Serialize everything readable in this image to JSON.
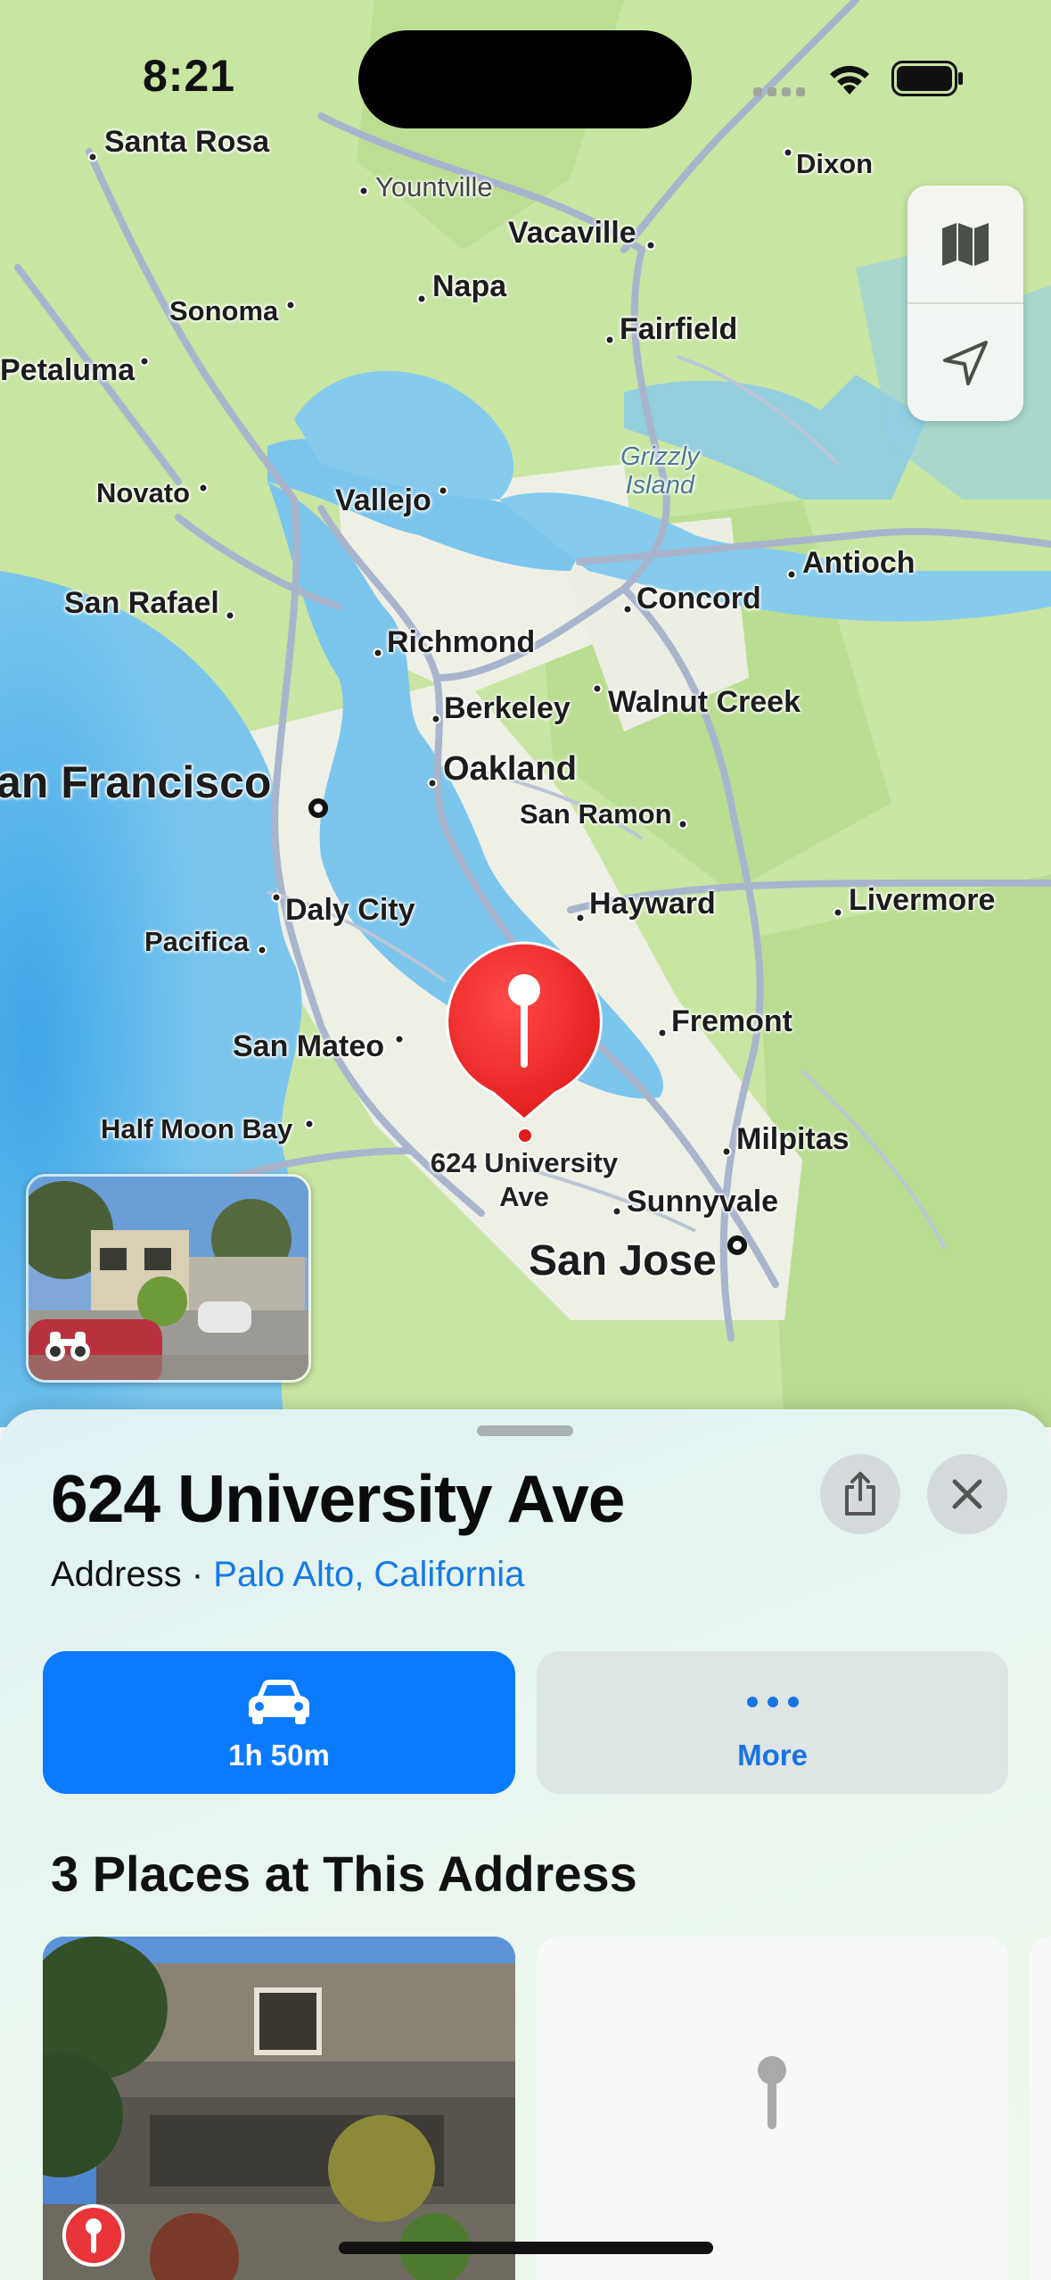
{
  "status_bar": {
    "time": "8:21"
  },
  "map": {
    "cities": [
      {
        "name": "Santa Rosa"
      },
      {
        "name": "Yountville"
      },
      {
        "name": "Dixon"
      },
      {
        "name": "Vacaville"
      },
      {
        "name": "Napa"
      },
      {
        "name": "Sonoma"
      },
      {
        "name": "Fairfield"
      },
      {
        "name": "Petaluma"
      },
      {
        "name": "Novato"
      },
      {
        "name": "Vallejo"
      },
      {
        "name": "Antioch"
      },
      {
        "name": "San Rafael"
      },
      {
        "name": "Concord"
      },
      {
        "name": "Richmond"
      },
      {
        "name": "Walnut Creek"
      },
      {
        "name": "Berkeley"
      },
      {
        "name": "an Francisco"
      },
      {
        "name": "Oakland"
      },
      {
        "name": "San Ramon"
      },
      {
        "name": "Hayward"
      },
      {
        "name": "Livermore"
      },
      {
        "name": "Daly City"
      },
      {
        "name": "Pacifica"
      },
      {
        "name": "Fremont"
      },
      {
        "name": "San Mateo"
      },
      {
        "name": "Half Moon Bay"
      },
      {
        "name": "Milpitas"
      },
      {
        "name": "Sunnyvale"
      },
      {
        "name": "San Jose"
      }
    ],
    "island_label": [
      "Grizzly",
      "Island"
    ],
    "pin_label": [
      "624 University",
      "Ave"
    ],
    "controls": {
      "map_mode_icon": "map-icon",
      "locate_icon": "location-arrow-icon"
    },
    "lookaround_icon": "binoculars-icon"
  },
  "sheet": {
    "title": "624 University Ave",
    "subtitle_type": "Address · ",
    "subtitle_location": "Palo Alto, California",
    "share_icon": "share-icon",
    "close_icon": "close-icon",
    "actions": [
      {
        "label": "1h 50m",
        "icon": "car-icon",
        "color": "#0a7bff"
      },
      {
        "label": "More",
        "icon": "ellipsis-icon",
        "color": "#dde5e5"
      }
    ],
    "section_title": "3 Places at This Address",
    "badge_color": "#e9343a"
  }
}
